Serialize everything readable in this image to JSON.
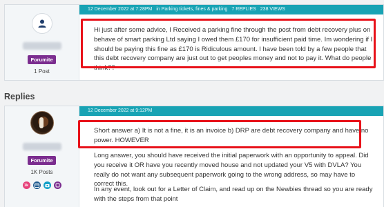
{
  "post1": {
    "date": "12 December 2022 at 7:28PM",
    "category": "in Parking tickets, fines & parking",
    "replies": "7 REPLIES",
    "views": "238 VIEWS",
    "badge": "Forumite",
    "post_count": "1 Post",
    "body": "Hi just after some advice, I Received a parking fine through the post from debt recovery plus on behave of smart parking Ltd saying I owed them £170 for insufficient paid time. Im wondering if I should be paying this fine as £170 is Ridiculous amount. I have been told by a few people that this debt recovery company are just out to get peoples money and not to pay it. What do people think??"
  },
  "replies_heading": "Replies",
  "post2": {
    "date": "12 December 2022 at 9:12PM",
    "badge": "Forumite",
    "post_count": "1K Posts",
    "icons": [
      {
        "name": "1k-icon",
        "label": "1k",
        "color": "#e6417a"
      },
      {
        "name": "calendar-icon",
        "label": "",
        "color": "#1e5a8f"
      },
      {
        "name": "camera-icon",
        "label": "",
        "color": "#12a0c8"
      },
      {
        "name": "piggy-bank-icon",
        "label": "",
        "color": "#7b2d8f"
      }
    ],
    "para1": "Short answer a) It is not a fine, it is an invoice b) DRP are debt recovery company and have no power. HOWEVER",
    "para2": "Long answer, you should have received the initial paperwork with an opportunity to appeal. Did you receive it OR have you recently moved house and not updated your V5 with DVLA? You really do not want any subsequent paperwork going to the wrong address, so may have to correct this.",
    "para3": "In any event, look out for a Letter of Claim, and read up on the Newbies thread so you are ready with the steps from that point"
  },
  "colors": {
    "bar": "#18a3b4",
    "badge": "#7b2d8f",
    "highlight": "#e8121a"
  }
}
